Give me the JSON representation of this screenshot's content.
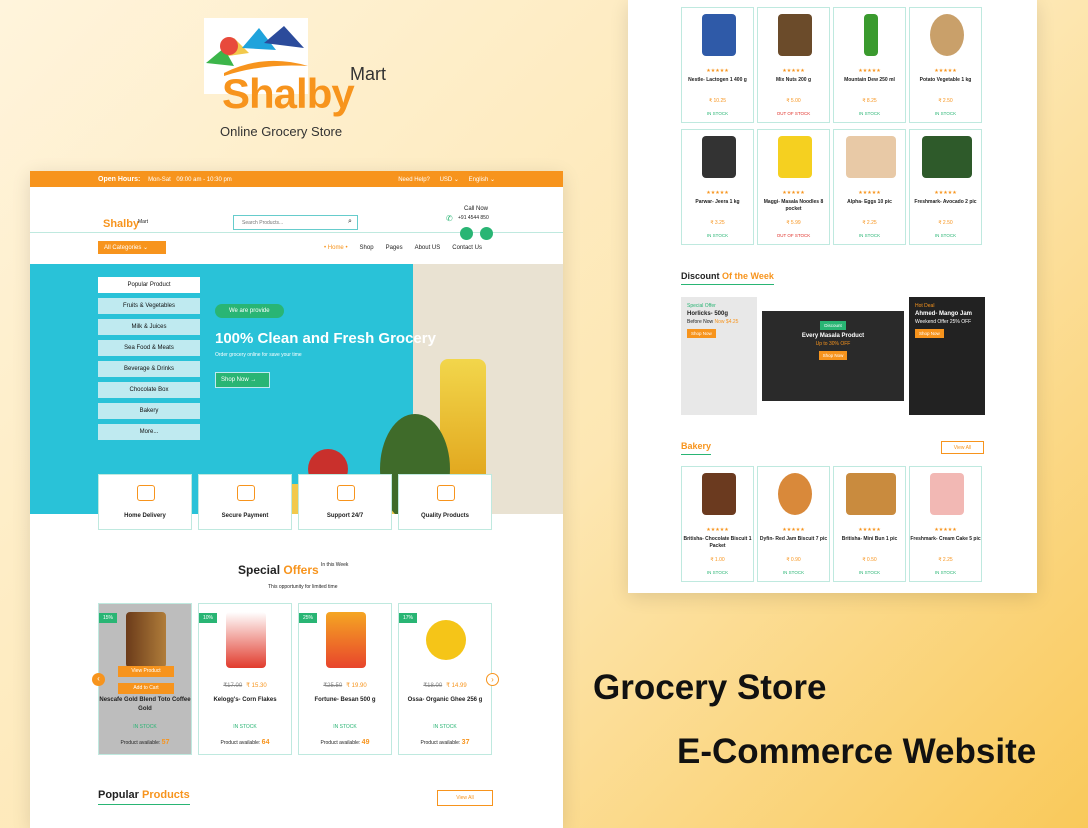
{
  "brand": {
    "logo_text": "Shalby",
    "sub": "Mart",
    "tagline": "Online Grocery Store"
  },
  "topbar": {
    "open_hours": "Open Hours:",
    "days": "Mon-Sat",
    "time": "09:00 am - 10:30 pm",
    "need_help": "Need Help?",
    "currency": "USD",
    "language": "English"
  },
  "header": {
    "search_placeholder": "Search Products...",
    "call_label": "Call Now",
    "phone": "+91 4544 850"
  },
  "nav": {
    "all_categories": "All Categories",
    "links": [
      "• Home •",
      "Shop",
      "Pages",
      "About US",
      "Contact Us"
    ]
  },
  "categories": [
    "Popular Product",
    "Fruits & Vegetables",
    "Milk & Juices",
    "Sea Food & Meats",
    "Beverage & Drinks",
    "Chocolate Box",
    "Bakery",
    "More..."
  ],
  "hero": {
    "pill": "We are provide",
    "title": "100% Clean and Fresh Grocery",
    "subtitle": "Order grocery online for save your time",
    "button": "Shop Now"
  },
  "features": [
    "Home Delivery",
    "Secure Payment",
    "Support 24/7",
    "Quality Products"
  ],
  "special": {
    "title_a": "Special ",
    "title_b": "Offers",
    "week": "In this Week",
    "subtitle": "This opportunity for limited time"
  },
  "offers": [
    {
      "badge": "15%",
      "old": "",
      "price": "",
      "name": "Nescafe Gold Blend Toto Coffee Gold",
      "stock": "IN STOCK",
      "avail_label": "Product available:",
      "avail": "57",
      "view": "View Product",
      "add": "Add to Cart"
    },
    {
      "badge": "10%",
      "old": "₹17.00",
      "price": "₹ 15.30",
      "name": "Kelogg's- Corn Flakes",
      "stock": "IN STOCK",
      "avail_label": "Product available:",
      "avail": "64"
    },
    {
      "badge": "25%",
      "old": "₹25.50",
      "price": "₹ 19.90",
      "name": "Fortune- Besan 500 g",
      "stock": "IN STOCK",
      "avail_label": "Product available:",
      "avail": "49"
    },
    {
      "badge": "17%",
      "old": "₹18.00",
      "price": "₹ 14.99",
      "name": "Ossa- Organic Ghee 256 g",
      "stock": "IN STOCK",
      "avail_label": "Product available:",
      "avail": "37"
    }
  ],
  "popular": {
    "title_a": "Popular ",
    "title_b": "Products",
    "view_all": "View All"
  },
  "grid1": [
    {
      "stars": "★★★★★",
      "name": "Nestle- Lactogen 1 400 g",
      "price": "₹ 10.25",
      "stock": "IN STOCK",
      "out": false
    },
    {
      "stars": "★★★★★",
      "name": "Mix Nuts 200 g",
      "price": "₹ 5.00",
      "stock": "OUT OF STOCK",
      "out": true
    },
    {
      "stars": "★★★★★",
      "name": "Mountain Dew 250 ml",
      "price": "₹ 8.25",
      "stock": "IN STOCK",
      "out": false
    },
    {
      "stars": "★★★★★",
      "name": "Potato Vegetable 1 kg",
      "price": "₹ 2.50",
      "stock": "IN STOCK",
      "out": false
    }
  ],
  "grid2": [
    {
      "stars": "★★★★★",
      "name": "Parwar- Jeera 1 kg",
      "price": "₹ 3.25",
      "stock": "IN STOCK",
      "out": false
    },
    {
      "stars": "★★★★★",
      "name": "Maggi- Masala Noodles 8 pocket",
      "price": "₹ 5.99",
      "stock": "OUT OF STOCK",
      "out": true
    },
    {
      "stars": "★★★★★",
      "name": "Alpha- Eggs 10 pic",
      "price": "₹ 2.25",
      "stock": "IN STOCK",
      "out": false
    },
    {
      "stars": "★★★★★",
      "name": "Freshmark- Avocado 2 pic",
      "price": "₹ 2.50",
      "stock": "IN STOCK",
      "out": false
    }
  ],
  "discount": {
    "title_a": "Discount ",
    "title_b": "Of the Week",
    "b1": {
      "tag": "Special Offer",
      "name": "Horlicks- 500g",
      "before": "Before Now",
      "now": "Now $4.25",
      "btn": "Shop Now"
    },
    "b2": {
      "tag": "Discount",
      "name": "Every Masala Product",
      "off": "Up to 30% OFF",
      "btn": "Shop Now"
    },
    "b3": {
      "tag": "Hot Deal",
      "name": "Ahmed- Mango Jam",
      "off": "Weekend Offer 25% OFF",
      "btn": "Shop Now"
    }
  },
  "bakery": {
    "title": "Bakery",
    "view_all": "View All",
    "items": [
      {
        "stars": "★★★★★",
        "name": "Britisha- Chocolate Biscuit 1 Packet",
        "price": "₹ 1.00",
        "stock": "IN STOCK",
        "out": false
      },
      {
        "stars": "★★★★★",
        "name": "Dyfin- Red Jam Biscuit 7 pic",
        "price": "₹ 0.90",
        "stock": "IN STOCK",
        "out": false
      },
      {
        "stars": "★★★★★",
        "name": "Britisha- Mini Bun 1 pic",
        "price": "₹ 0.50",
        "stock": "IN STOCK",
        "out": false
      },
      {
        "stars": "★★★★★",
        "name": "Freshmark- Cream Cake 5 pic",
        "price": "₹ 2.25",
        "stock": "IN STOCK",
        "out": false
      }
    ]
  },
  "headline": {
    "line1": "Grocery Store",
    "line2": "E-Commerce Website"
  },
  "colors": {
    "accent": "#f7941d",
    "green": "#29b574",
    "cyan": "#29c2d8"
  }
}
